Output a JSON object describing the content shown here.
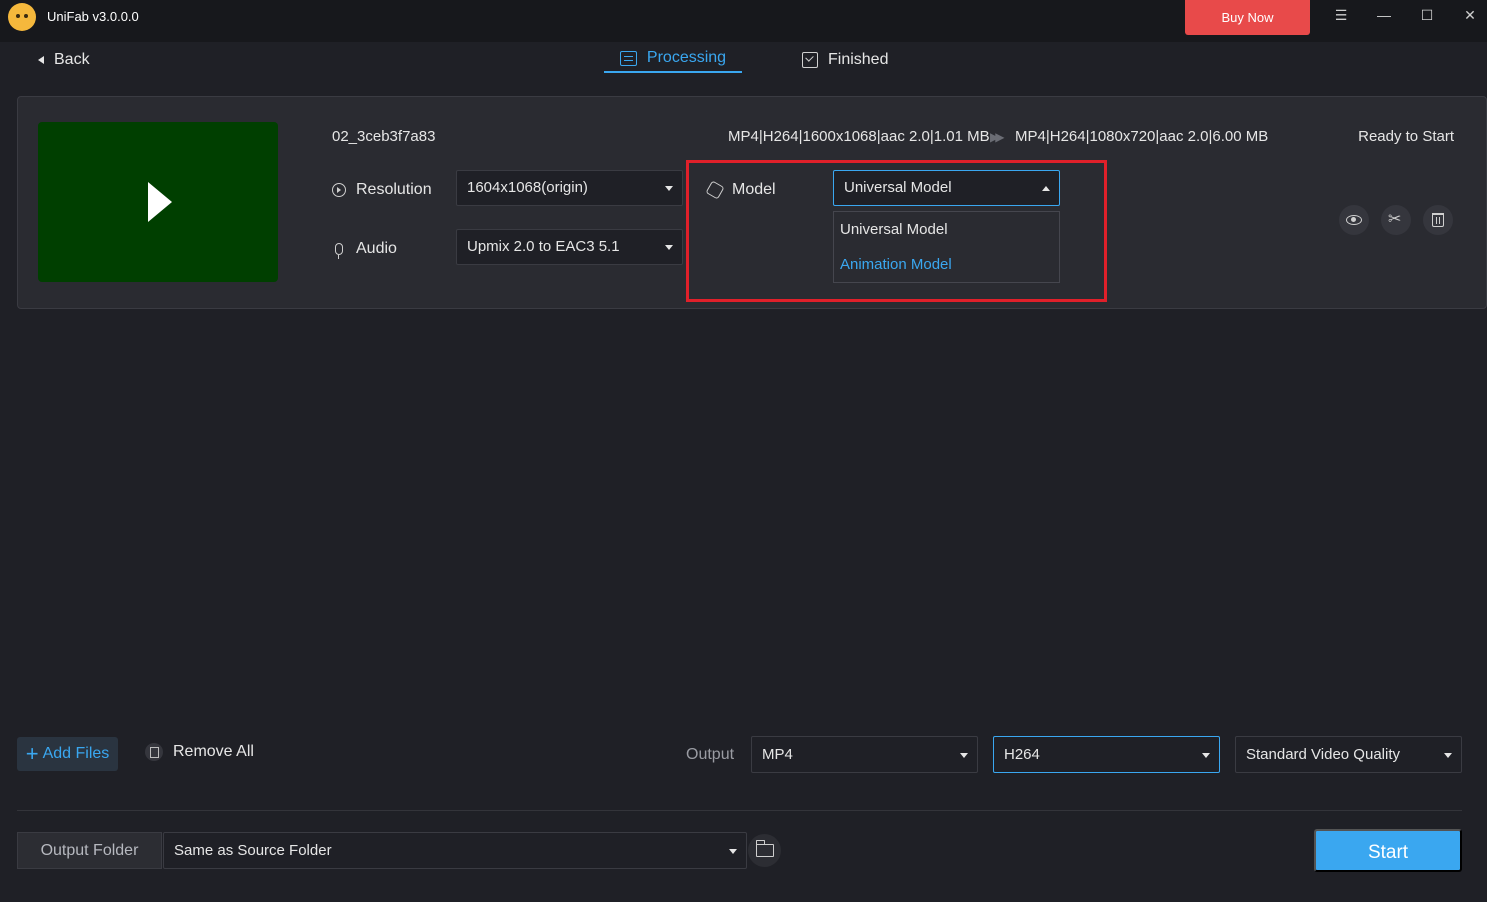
{
  "app": {
    "title": "UniFab v3.0.0.0",
    "buy_label": "Buy Now",
    "menu_glyph": "☰",
    "min_glyph": "—",
    "max_glyph": "☐",
    "close_glyph": "✕"
  },
  "nav": {
    "back_label": "Back",
    "tabs": [
      {
        "label": "Processing",
        "active": true
      },
      {
        "label": "Finished",
        "active": false
      }
    ]
  },
  "file": {
    "name": "02_3ceb3f7a83",
    "source_info": "MP4|H264|1600x1068|aac 2.0|1.01 MB",
    "target_info": "MP4|H264|1080x720|aac 2.0|6.00 MB",
    "status": "Ready to Start",
    "resolution": {
      "label": "Resolution",
      "value": "1604x1068(origin)"
    },
    "audio": {
      "label": "Audio",
      "value": "Upmix 2.0 to EAC3 5.1"
    },
    "model": {
      "label": "Model",
      "value": "Universal Model",
      "options": [
        {
          "label": "Universal Model",
          "selected": true
        },
        {
          "label": "Animation Model",
          "selected": false
        }
      ]
    }
  },
  "toolbar": {
    "add_files_label": "Add Files",
    "remove_all_label": "Remove All",
    "output_label": "Output",
    "format": "MP4",
    "codec": "H264",
    "quality": "Standard Video Quality"
  },
  "footer": {
    "output_folder_label": "Output Folder",
    "output_folder_value": "Same as Source Folder",
    "start_label": "Start"
  },
  "colors": {
    "accent": "#3aa7f0",
    "buy": "#e84a4a",
    "highlight": "#e0202a",
    "thumbnail": "#003f00"
  }
}
